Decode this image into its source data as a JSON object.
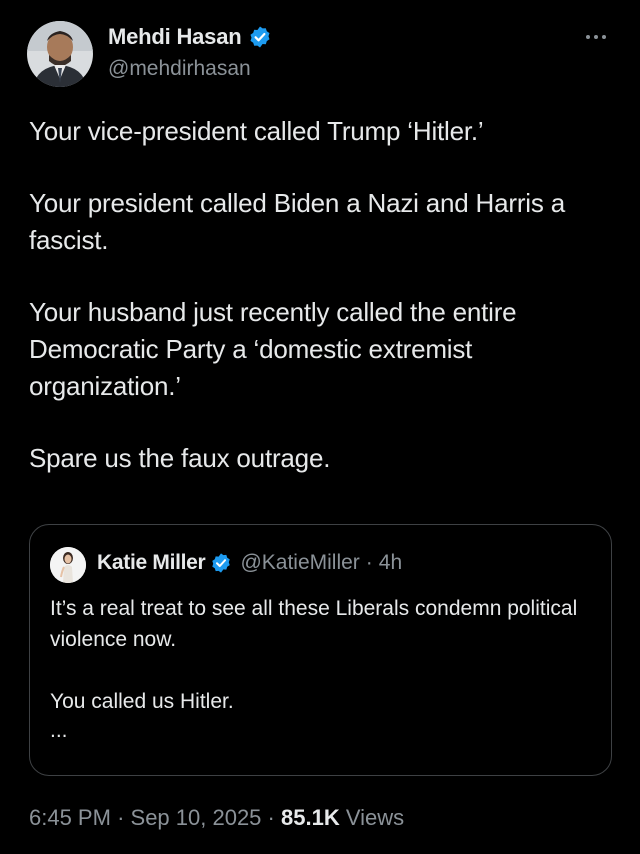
{
  "author": {
    "name": "Mehdi Hasan",
    "handle": "@mehdirhasan",
    "verified": true,
    "avatar_icon": "person-avatar"
  },
  "more_icon": "more-horizontal-icon",
  "tweet": {
    "paragraphs": [
      "Your vice-president called Trump ‘Hitler.’",
      "Your president called Biden a Nazi and Harris a fascist.",
      "Your husband just recently called the entire Democratic Party a ‘domestic extremist organization.’",
      "Spare us the faux outrage."
    ]
  },
  "quote": {
    "name": "Katie Miller",
    "handle": "@KatieMiller",
    "separator": "·",
    "time": "4h",
    "verified": true,
    "paragraphs": [
      "It’s a real treat to see all these Liberals condemn political violence now.",
      "You called us Hitler."
    ],
    "ellipsis": "..."
  },
  "footer": {
    "time": "6:45 PM",
    "sep1": "·",
    "date": "Sep 10, 2025",
    "sep2": "·",
    "views_count": "85.1K",
    "views_label": "Views"
  },
  "colors": {
    "background": "#000000",
    "text": "#e7e9ea",
    "secondary": "#8b9298",
    "verified_blue": "#1d9bf0",
    "border": "#3e4144"
  }
}
